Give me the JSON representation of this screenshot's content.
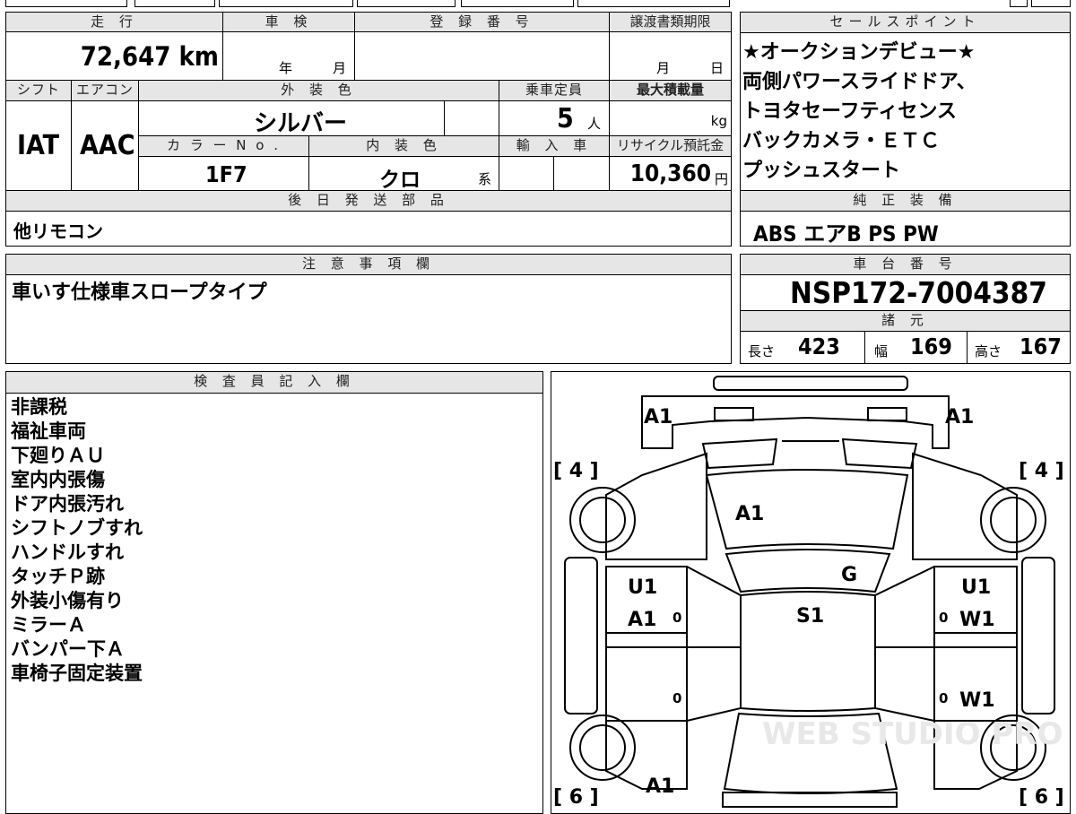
{
  "top_strip": {
    "partial_text": "■■■"
  },
  "vehicle": {
    "mileage_label": "走 行",
    "mileage": "72,647 km",
    "inspection_label": "車 検",
    "inspection_year_unit": "年",
    "inspection_month_unit": "月",
    "registration_label": "登 録 番 号",
    "transfer_label": "譲渡書類期限",
    "transfer_month_unit": "月",
    "transfer_day_unit": "日",
    "shift_label": "シフト",
    "shift": "IAT",
    "aircon_label": "エアコン",
    "aircon": "AAC",
    "exterior_color_label": "外 装 色",
    "exterior_color": "シルバー",
    "seating_label": "乗車定員",
    "seating": "5",
    "seating_unit": "人",
    "max_load_label": "最大積載量",
    "max_load_unit": "kg",
    "color_no_label": "カ ラ ー N o .",
    "color_no": "1F7",
    "interior_color_label": "内 装 色",
    "interior_color": "クロ",
    "interior_suffix": "系",
    "import_label": "輸 入 車",
    "recycle_label": "リサイクル預託金",
    "recycle_fee": "10,360",
    "recycle_unit": "円"
  },
  "later_parts": {
    "label": "後 日 発 送 部 品",
    "text": "他リモコン"
  },
  "sales_points": {
    "label": "セールスポイント",
    "lines": [
      "★オークションデビュー★",
      "両側パワースライドドア、",
      "トヨタセーフティセンス",
      "バックカメラ・ＥＴＣ",
      "プッシュスタート"
    ]
  },
  "genuine_equipment": {
    "label": "純 正 装 備",
    "text": "ABS エアB PS PW"
  },
  "notes": {
    "label": "注 意 事 項 欄",
    "text": "車いす仕様車スロープタイプ"
  },
  "chassis": {
    "label": "車 台 番 号",
    "number": "NSP172-7004387"
  },
  "specs": {
    "label": "諸 元",
    "length_label": "長さ",
    "length": "423",
    "width_label": "幅",
    "width": "169",
    "height_label": "高さ",
    "height": "167"
  },
  "inspector": {
    "label": "検 査 員 記 入 欄",
    "lines": [
      "非課税",
      "福祉車両",
      "下廻りＡＵ",
      "室内内張傷",
      "ドア内張汚れ",
      "シフトノブすれ",
      "ハンドルすれ",
      "タッチＰ跡",
      "外装小傷有り",
      "ミラーＡ",
      "バンパー下Ａ",
      "車椅子固定装置"
    ]
  },
  "diagram": {
    "tire_front_left": "[ 4 ]",
    "tire_front_right": "[ 4 ]",
    "tire_rear_left": "[ 6 ]",
    "tire_rear_right": "[ 6 ]",
    "front_corner_left": "A1",
    "front_corner_right": "A1",
    "hood": "A1",
    "windshield_mark": "G",
    "roof": "S1",
    "front_door_left_top": "U1",
    "front_door_left_bottom": "A1",
    "front_door_right_top": "U1",
    "front_door_right_bottom": "W1",
    "rear_door_right": "W1",
    "rear_left": "A1",
    "zero": "0",
    "watermark": "WEB STUDIO PRO"
  }
}
